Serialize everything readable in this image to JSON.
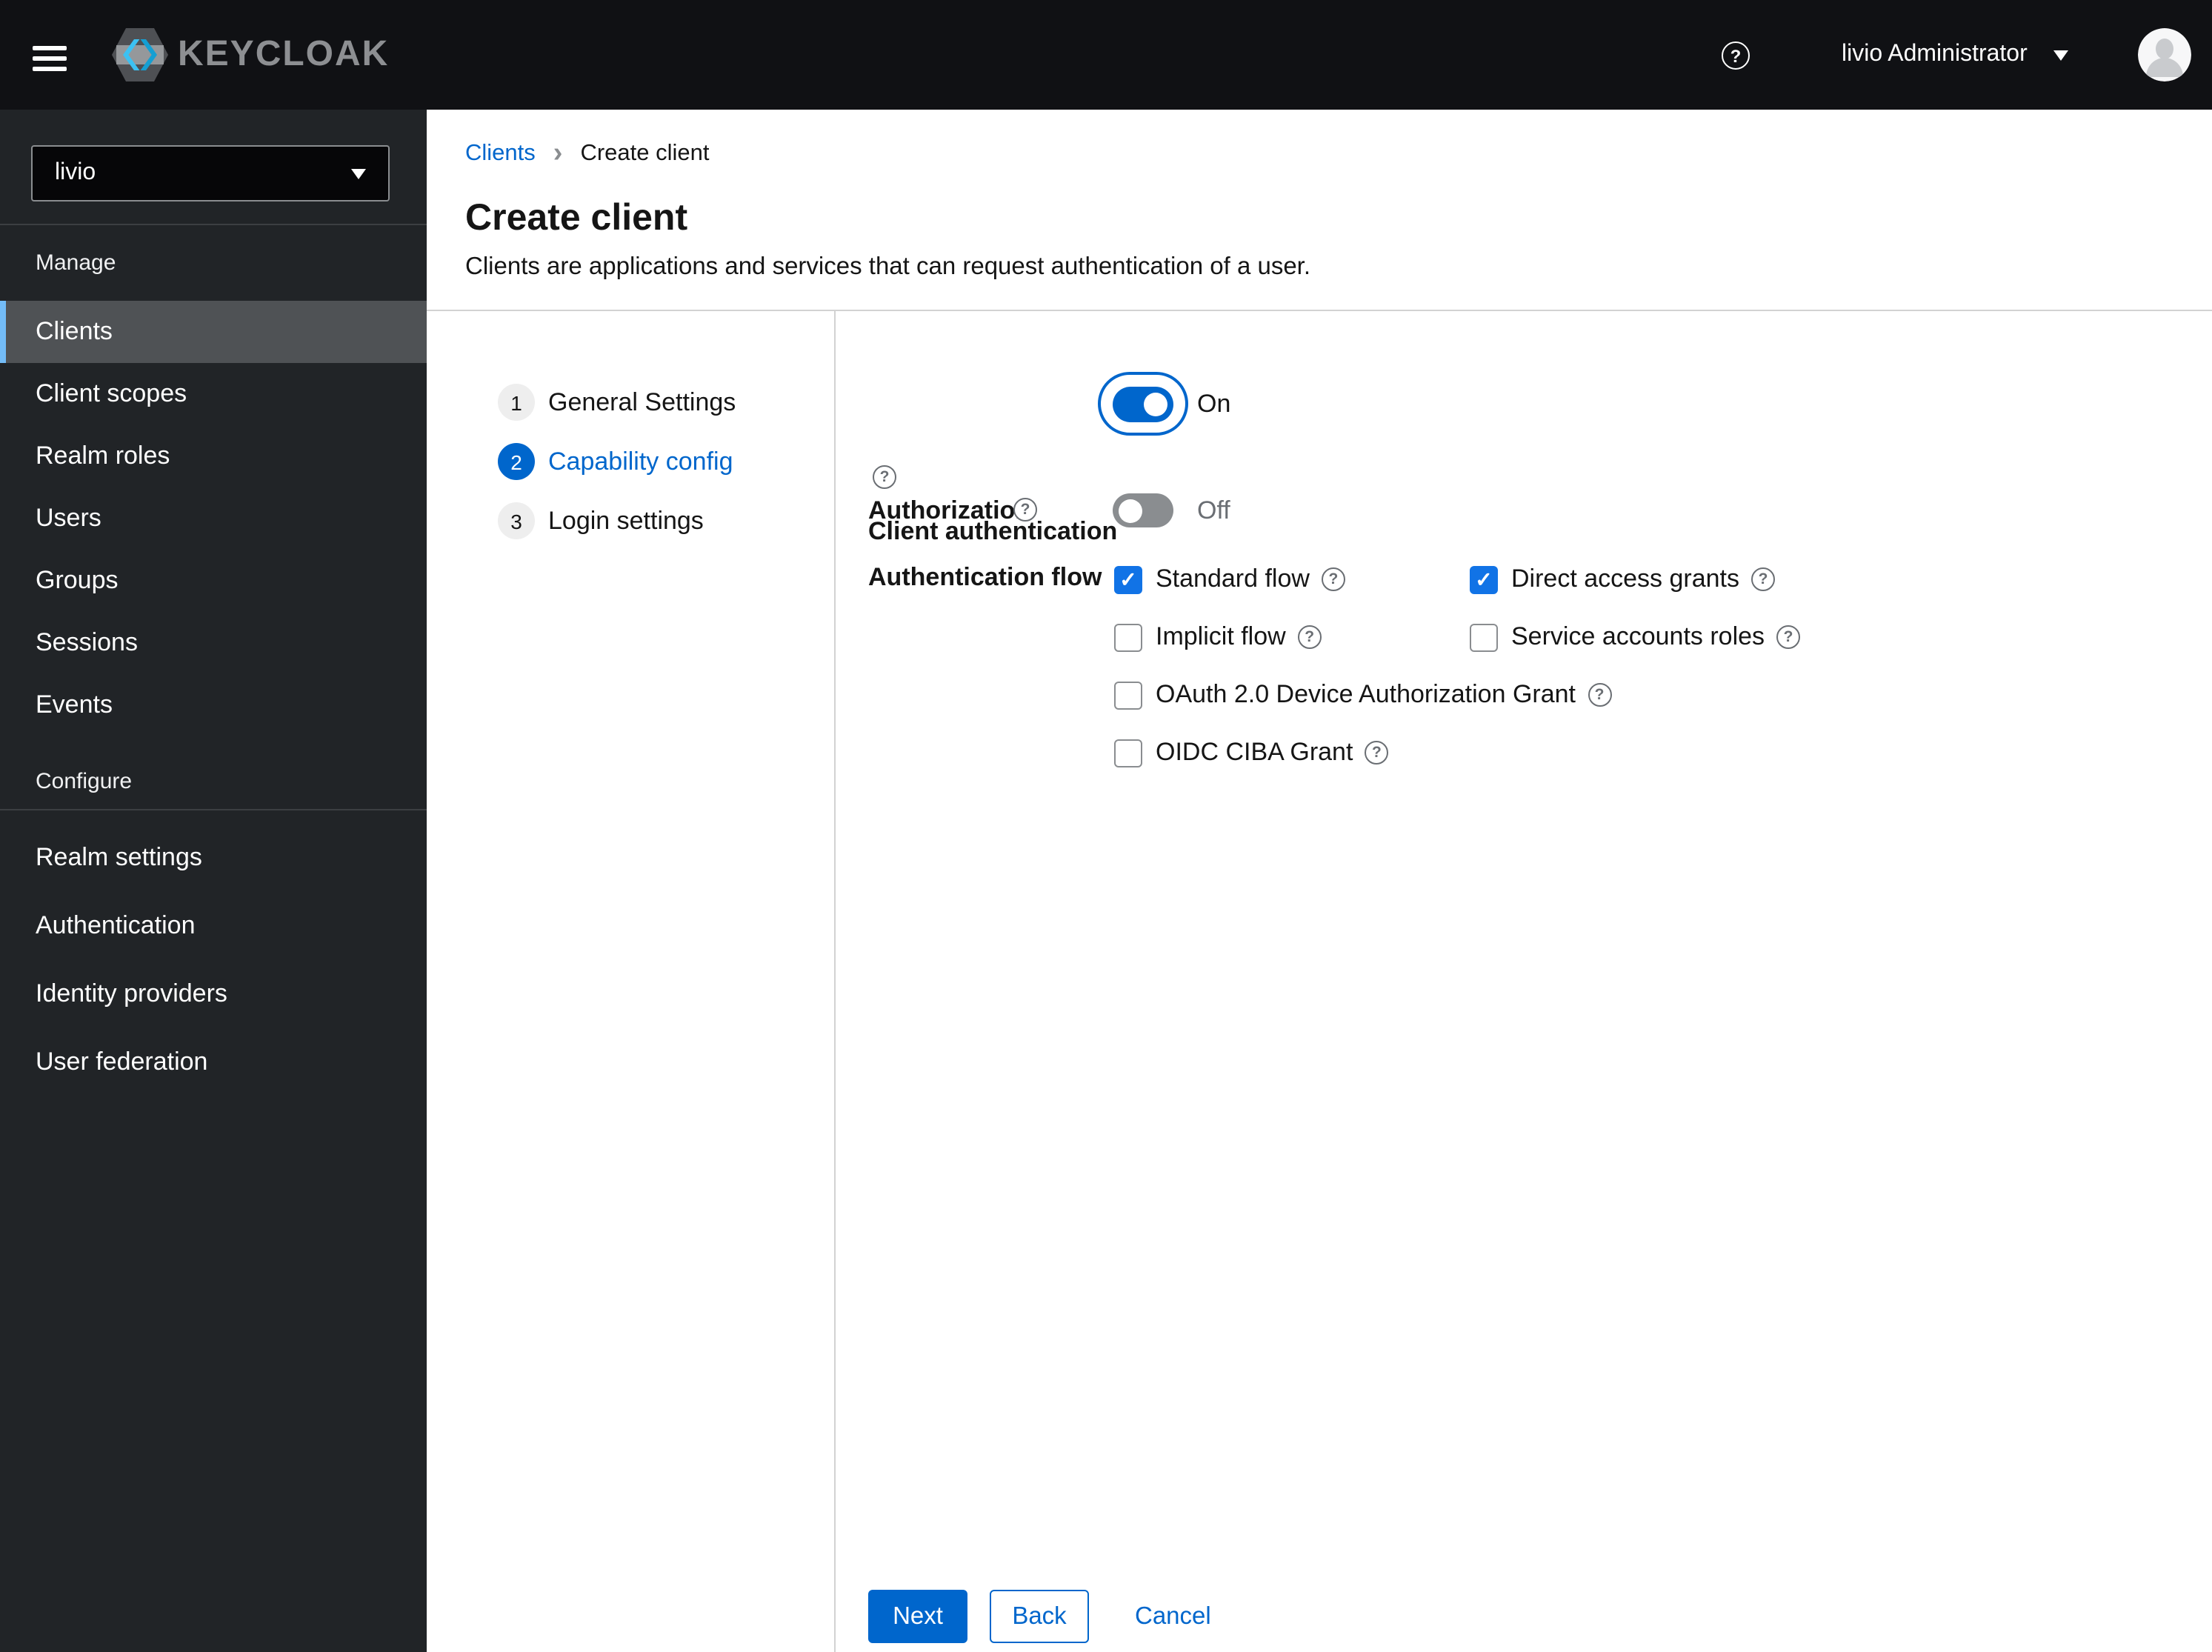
{
  "masthead": {
    "brand": "KEYCLOAK",
    "user": "livio Administrator"
  },
  "icons": {
    "question": "?",
    "check": "✓",
    "breadcrumb_separator": "›"
  },
  "sidebar": {
    "realm": "livio",
    "sections": [
      {
        "title": "Manage",
        "items": [
          {
            "label": "Clients",
            "active": true
          },
          {
            "label": "Client scopes",
            "active": false
          },
          {
            "label": "Realm roles",
            "active": false
          },
          {
            "label": "Users",
            "active": false
          },
          {
            "label": "Groups",
            "active": false
          },
          {
            "label": "Sessions",
            "active": false
          },
          {
            "label": "Events",
            "active": false
          }
        ]
      },
      {
        "title": "Configure",
        "items": [
          {
            "label": "Realm settings",
            "active": false
          },
          {
            "label": "Authentication",
            "active": false
          },
          {
            "label": "Identity providers",
            "active": false
          },
          {
            "label": "User federation",
            "active": false
          }
        ]
      }
    ]
  },
  "breadcrumb": {
    "parent": "Clients",
    "current": "Create client"
  },
  "page": {
    "title": "Create client",
    "subtitle": "Clients are applications and services that can request authentication of a user."
  },
  "wizard": {
    "steps": [
      {
        "number": "1",
        "label": "General Settings",
        "active": false
      },
      {
        "number": "2",
        "label": "Capability config",
        "active": true
      },
      {
        "number": "3",
        "label": "Login settings",
        "active": false
      }
    ]
  },
  "form": {
    "client_authentication": {
      "label": "Client authentication",
      "state": "On",
      "enabled": true
    },
    "authorization": {
      "label": "Authorization",
      "state": "Off",
      "enabled": false
    },
    "authentication_flow": {
      "label": "Authentication flow",
      "options": [
        {
          "label": "Standard flow",
          "checked": true
        },
        {
          "label": "Direct access grants",
          "checked": true
        },
        {
          "label": "Implicit flow",
          "checked": false
        },
        {
          "label": "Service accounts roles",
          "checked": false
        },
        {
          "label": "OAuth 2.0 Device Authorization Grant",
          "checked": false
        },
        {
          "label": "OIDC CIBA Grant",
          "checked": false
        }
      ]
    }
  },
  "footer": {
    "next": "Next",
    "back": "Back",
    "cancel": "Cancel"
  },
  "colors": {
    "accent": "#0066cc",
    "checkbox_checked": "#1173e6",
    "toggle_off": "#8a8d90",
    "masthead_bg": "#101114",
    "sidebar_bg": "#212427",
    "selected_nav_bg": "#4f5255",
    "selected_nav_border": "#73bcf7",
    "divider": "#d2d2d2",
    "muted_text": "#6a6e73"
  }
}
